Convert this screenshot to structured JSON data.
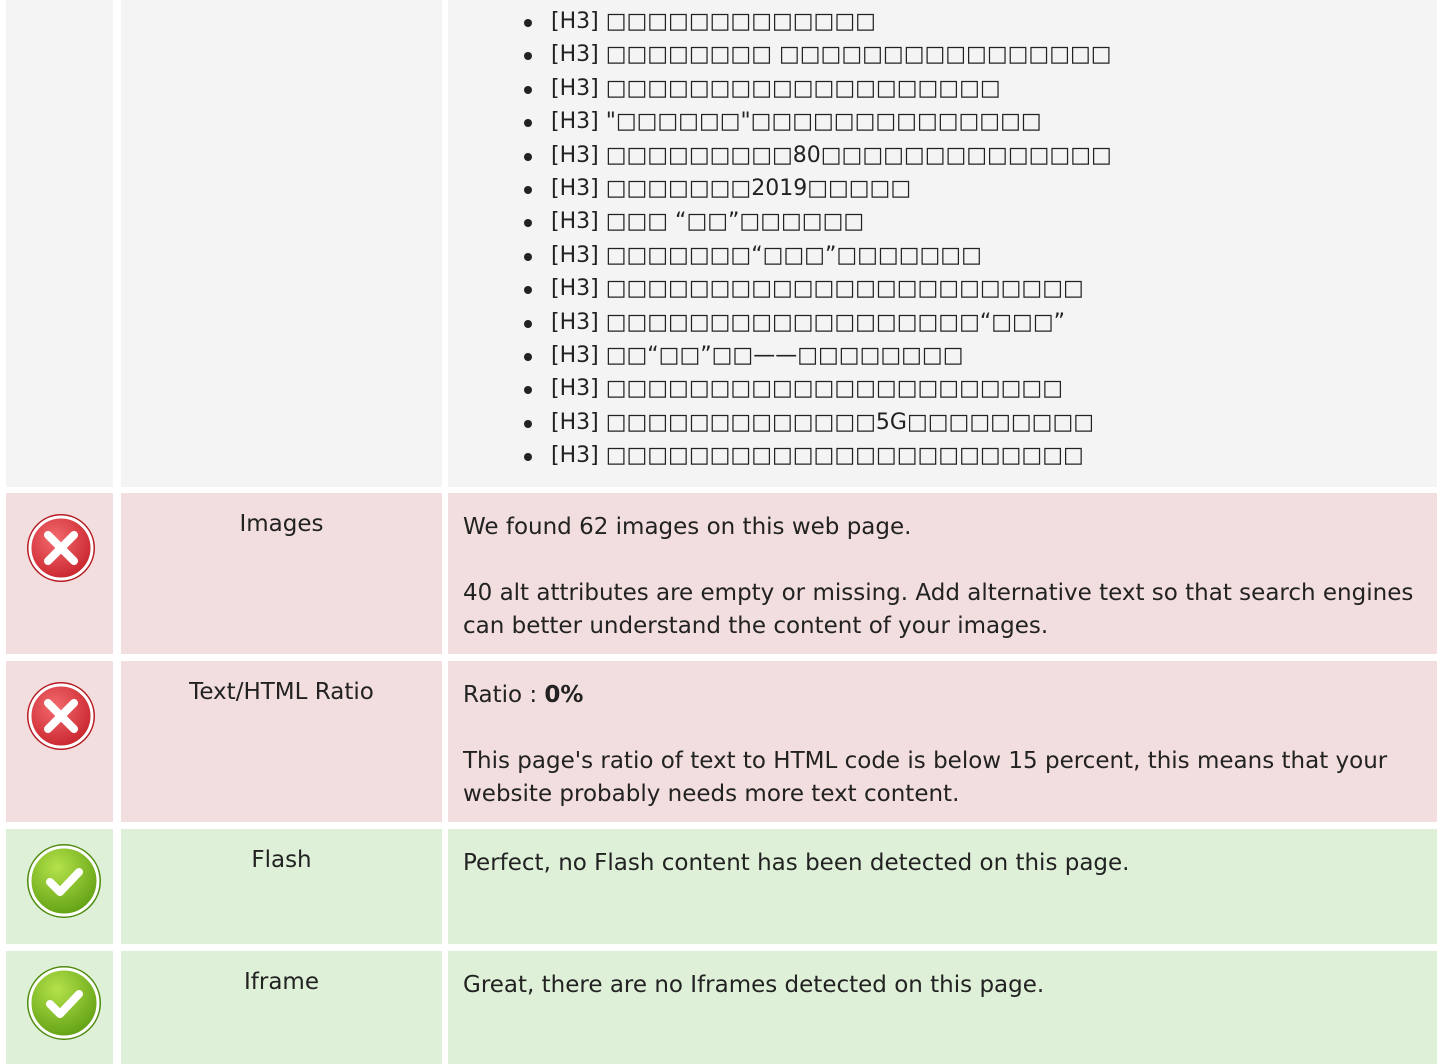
{
  "headings_section": {
    "h3_items": [
      "[H3] □□□□□□□□□□□□□",
      "[H3] □□□□□□□□ □□□□□□□□□□□□□□□□",
      "[H3] □□□□□□□□□□□□□□□□□□□",
      "[H3] \"□□□□□□\"□□□□□□□□□□□□□□",
      "[H3] □□□□□□□□□80□□□□□□□□□□□□□□",
      "[H3] □□□□□□□2019□□□□□",
      "[H3] □□□ “□□”□□□□□□",
      "[H3] □□□□□□□“□□□”□□□□□□□",
      "[H3] □□□□□□□□□□□□□□□□□□□□□□□",
      "[H3] □□□□□□□□□□□□□□□□□□“□□□”",
      "[H3] □□“□□”□□——□□□□□□□□",
      "[H3] □□□□□□□□□□□□□□□□□□□□□□",
      "[H3] □□□□□□□□□□□□□5G□□□□□□□□□",
      "[H3] □□□□□□□□□□□□□□□□□□□□□□□"
    ]
  },
  "checks": [
    {
      "status": "fail",
      "icon": "error-x-icon",
      "label": "Images",
      "lines": [
        "We found 62 images on this web page.",
        "40 alt attributes are empty or missing. Add alternative text so that search engines can better understand the content of your images."
      ]
    },
    {
      "status": "fail",
      "icon": "error-x-icon",
      "label": "Text/HTML Ratio",
      "ratio_prefix": "Ratio : ",
      "ratio_value": "0%",
      "lines": [
        "This page's ratio of text to HTML code is below 15 percent, this means that your website probably needs more text content."
      ]
    },
    {
      "status": "pass",
      "icon": "checkmark-icon",
      "label": "Flash",
      "lines": [
        "Perfect, no Flash content has been detected on this page."
      ]
    },
    {
      "status": "pass",
      "icon": "checkmark-icon",
      "label": "Iframe",
      "lines": [
        "Great, there are no Iframes detected on this page."
      ]
    }
  ],
  "colors": {
    "fail_background": "#f2dede",
    "pass_background": "#dff0d8",
    "neutral_background": "#f4f4f4",
    "error_red": "#d9363e",
    "success_green": "#7cbf1f"
  }
}
